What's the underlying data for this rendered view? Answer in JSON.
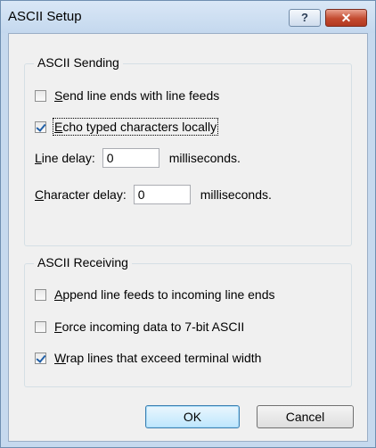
{
  "window": {
    "title": "ASCII Setup",
    "help_glyph": "?",
    "close_glyph": "✕"
  },
  "sending": {
    "legend": "ASCII Sending",
    "send_line_ends": {
      "label_u": "S",
      "label_rest": "end line ends with line feeds",
      "checked": false
    },
    "echo_typed": {
      "label_u": "E",
      "label_rest": "cho typed characters locally",
      "checked": true
    },
    "line_delay": {
      "label_u": "L",
      "label_rest": "ine delay:",
      "value": "0",
      "suffix": "milliseconds."
    },
    "char_delay": {
      "label_u": "C",
      "label_rest": "haracter delay:",
      "value": "0",
      "suffix": "milliseconds."
    }
  },
  "receiving": {
    "legend": "ASCII Receiving",
    "append_lf": {
      "label_u": "A",
      "label_rest": "ppend line feeds to incoming line ends",
      "checked": false
    },
    "force_7bit": {
      "label_u": "F",
      "label_rest": "orce incoming data to 7-bit ASCII",
      "checked": false
    },
    "wrap_lines": {
      "label_u": "W",
      "label_rest": "rap lines that exceed terminal width",
      "checked": true
    }
  },
  "buttons": {
    "ok": "OK",
    "cancel": "Cancel"
  },
  "icons": {
    "help": "help-icon",
    "close": "close-icon"
  },
  "colors": {
    "check": "#1f5fa8",
    "title_bar": "#c4d8ee",
    "close_button": "#c34a2f"
  }
}
